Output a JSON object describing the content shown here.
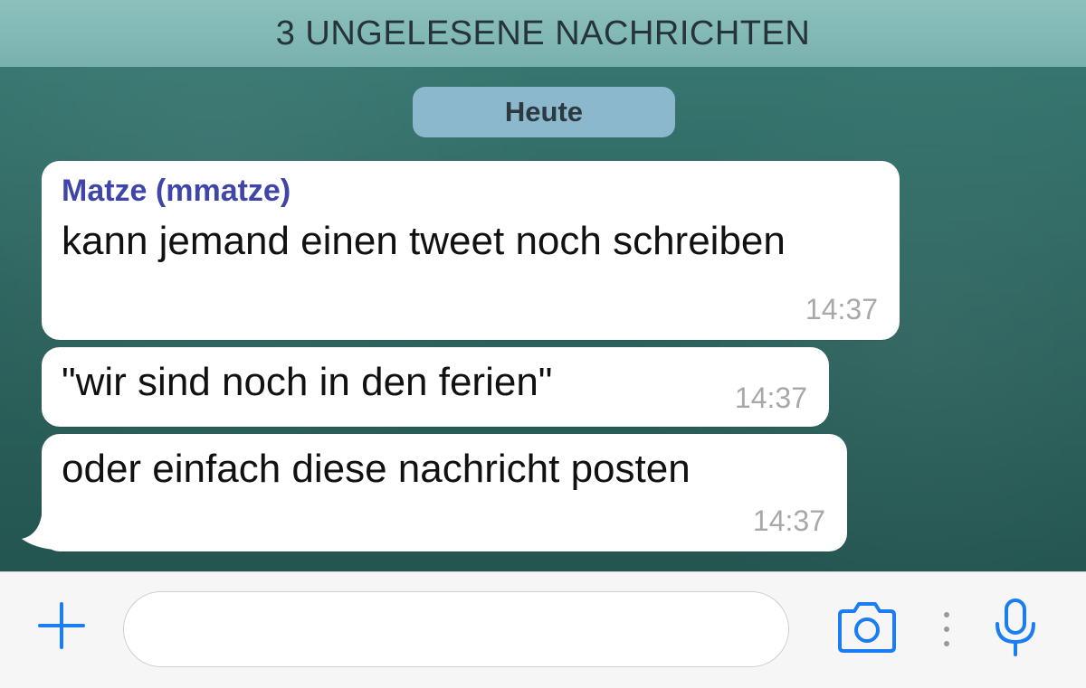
{
  "banner": {
    "unread_label": "3 UNGELESENE NACHRICHTEN"
  },
  "date_separator": {
    "label": "Heute"
  },
  "messages": [
    {
      "sender": "Matze (mmatze)",
      "text": "kann jemand einen tweet noch schreiben",
      "time": "14:37"
    },
    {
      "text": "\"wir sind noch in den ferien\"",
      "time": "14:37"
    },
    {
      "text": "oder einfach diese nachricht posten",
      "time": "14:37"
    }
  ],
  "composer": {
    "input_value": "",
    "icons": [
      "plus-icon",
      "camera-icon",
      "more-options-icon",
      "microphone-icon"
    ],
    "accent_color": "#1a7ef2"
  },
  "colors": {
    "banner_bg": "#86bbb8",
    "chat_bg": "#2f6b66",
    "date_pill_bg": "#8bb8cd",
    "sender_name": "#3f46a8",
    "bubble_bg": "#ffffff",
    "timestamp": "#a8a8a8"
  }
}
